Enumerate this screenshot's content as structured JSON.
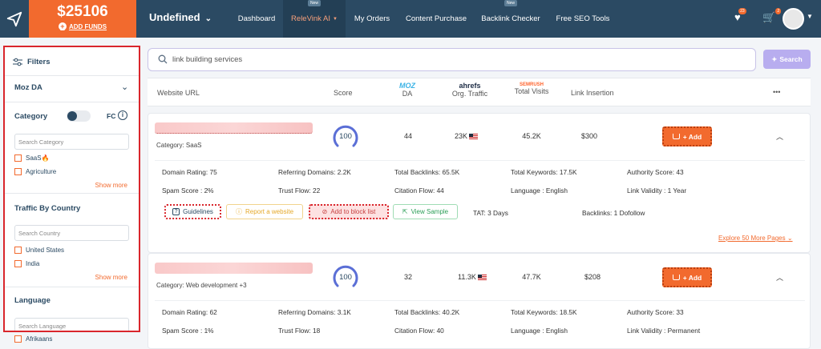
{
  "header": {
    "balance": "$25106",
    "add_funds": "ADD FUNDS",
    "project": "Undefined",
    "nav": [
      {
        "label": "Dashboard"
      },
      {
        "label": "ReleVink AI",
        "badge": "New"
      },
      {
        "label": "My Orders"
      },
      {
        "label": "Content Purchase"
      },
      {
        "label": "Backlink Checker",
        "badge": "New"
      },
      {
        "label": "Free SEO Tools"
      }
    ],
    "wishlist_count": "23",
    "cart_count": "2"
  },
  "sidebar": {
    "filters_label": "Filters",
    "moz_da": "Moz DA",
    "category_label": "Category",
    "fc_label": "FC",
    "search_category": "Search Category",
    "categories": [
      "SaaS🔥",
      "Agriculture"
    ],
    "show_more_1": "Show more",
    "traffic_label": "Traffic By Country",
    "search_country": "Search Country",
    "countries": [
      "United States",
      "India"
    ],
    "show_more_2": "Show more",
    "language_label": "Language",
    "search_language": "Search Language",
    "languages": [
      "Afrikaans"
    ]
  },
  "search": {
    "query": "link building services",
    "button": "Search"
  },
  "table_header": {
    "website_url": "Website URL",
    "score": "Score",
    "moz_brand": "MOZ",
    "da": "DA",
    "ahrefs_brand": "ahrefs",
    "org_traffic": "Org. Traffic",
    "semrush_brand": "SEMRUSH",
    "total_visits": "Total Visits",
    "link_insertion": "Link Insertion",
    "more": "•••"
  },
  "rows": [
    {
      "category": "Category: SaaS",
      "score": "100",
      "da": "44",
      "org_traffic": "23K",
      "total_visits": "45.2K",
      "link_insertion": "$300",
      "add_label": "+ Add",
      "details": {
        "domain_rating": "Domain Rating: 75",
        "referring_domains": "Referring Domains: 2.2K",
        "total_backlinks": "Total Backlinks: 65.5K",
        "total_keywords": "Total Keywords: 17.5K",
        "authority_score": "Authority Score: 43",
        "spam_score": "Spam Score : 2%",
        "trust_flow": "Trust Flow: 22",
        "citation_flow": "Citation Flow: 44",
        "language": "Language : English",
        "link_validity": "Link Validity : 1 Year"
      },
      "actions": {
        "guidelines": "Guidelines",
        "report": "Report a website",
        "block": "Add to block list",
        "sample": "View Sample",
        "tat": "TAT: 3 Days",
        "backlinks": "Backlinks: 1 Dofollow"
      },
      "explore": "Explore 50 More Pages"
    },
    {
      "category": "Category: Web development +3",
      "score": "100",
      "da": "32",
      "org_traffic": "11.3K",
      "total_visits": "47.7K",
      "link_insertion": "$208",
      "add_label": "+ Add",
      "details": {
        "domain_rating": "Domain Rating: 62",
        "referring_domains": "Referring Domains: 3.1K",
        "total_backlinks": "Total Backlinks: 40.2K",
        "total_keywords": "Total Keywords: 18.5K",
        "authority_score": "Authority Score: 33",
        "spam_score": "Spam Score : 1%",
        "trust_flow": "Trust Flow: 18",
        "citation_flow": "Citation Flow: 40",
        "language": "Language : English",
        "link_validity": "Link Validity : Permanent"
      }
    }
  ],
  "colors": {
    "brand_navy": "#2b4a63",
    "accent_orange": "#f26a2e",
    "gauge_blue": "#5b6fd6",
    "highlight_red": "#d9262c"
  }
}
